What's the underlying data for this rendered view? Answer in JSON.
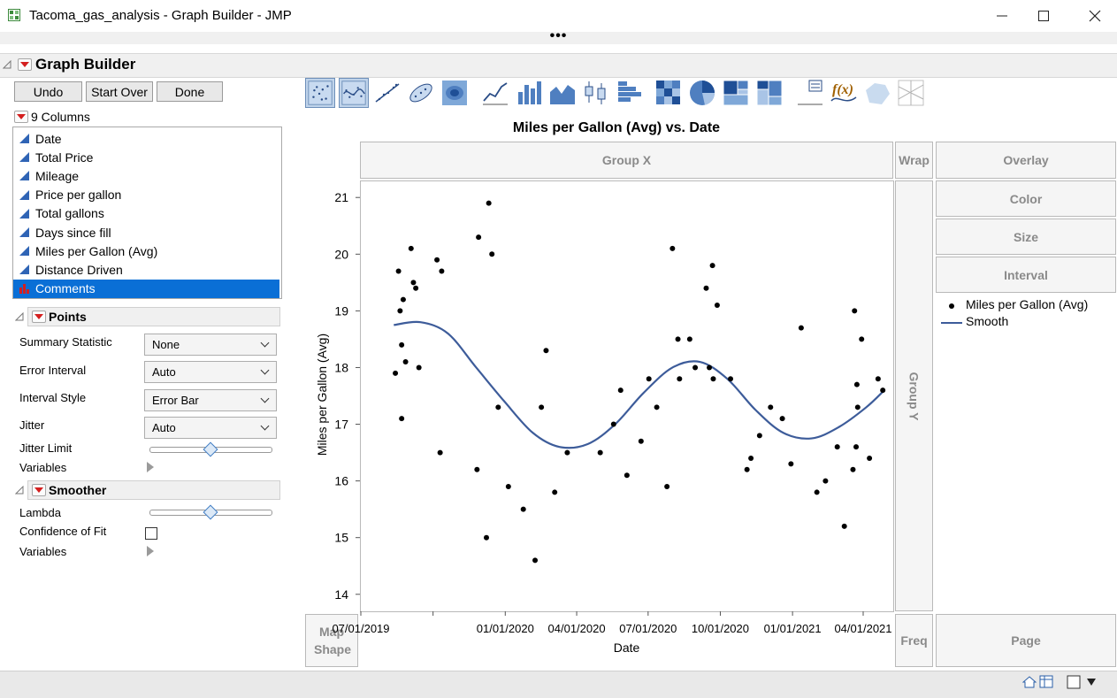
{
  "window": {
    "title": "Tacoma_gas_analysis - Graph Builder - JMP",
    "dots": "•••"
  },
  "header": {
    "title": "Graph Builder"
  },
  "buttons": {
    "undo": "Undo",
    "start_over": "Start Over",
    "done": "Done"
  },
  "columns": {
    "header": "9 Columns",
    "items": [
      {
        "label": "Date",
        "type": "continuous",
        "selected": false
      },
      {
        "label": "Total Price",
        "type": "continuous",
        "selected": false
      },
      {
        "label": "Mileage",
        "type": "continuous",
        "selected": false
      },
      {
        "label": "Price per gallon",
        "type": "continuous",
        "selected": false
      },
      {
        "label": "Total gallons",
        "type": "continuous",
        "selected": false
      },
      {
        "label": "Days since fill",
        "type": "continuous",
        "selected": false
      },
      {
        "label": "Miles per Gallon (Avg)",
        "type": "continuous",
        "selected": false
      },
      {
        "label": "Distance Driven",
        "type": "continuous",
        "selected": false
      },
      {
        "label": "Comments",
        "type": "nominal",
        "selected": true
      }
    ]
  },
  "points": {
    "title": "Points",
    "summary_statistic_label": "Summary Statistic",
    "summary_statistic_value": "None",
    "error_interval_label": "Error Interval",
    "error_interval_value": "Auto",
    "interval_style_label": "Interval Style",
    "interval_style_value": "Error Bar",
    "jitter_label": "Jitter",
    "jitter_value": "Auto",
    "jitter_limit_label": "Jitter Limit",
    "jitter_limit_level": 0.5,
    "variables_label": "Variables"
  },
  "smoother": {
    "title": "Smoother",
    "lambda_label": "Lambda",
    "lambda_level": 0.5,
    "confidence_label": "Confidence of Fit",
    "confidence_checked": false,
    "variables_label": "Variables"
  },
  "zones": {
    "group_x": "Group X",
    "wrap": "Wrap",
    "overlay": "Overlay",
    "color": "Color",
    "size": "Size",
    "interval": "Interval",
    "group_y": "Group Y",
    "map_shape": "Map Shape",
    "freq": "Freq",
    "page": "Page"
  },
  "legend": {
    "points_label": "Miles per Gallon (Avg)",
    "smooth_label": "Smooth"
  },
  "colors": {
    "accent": "#0a6fd6",
    "smooth_line": "#3d5c9a",
    "points": "#000000"
  },
  "chart_data": {
    "type": "scatter",
    "title": "Miles per Gallon (Avg) vs. Date",
    "xlabel": "Date",
    "ylabel": "Miles per Gallon (Avg)",
    "x_ticks": [
      "07/01/2019",
      "01/01/2020",
      "04/01/2020",
      "07/01/2020",
      "10/01/2020",
      "01/01/2021",
      "04/01/2021"
    ],
    "y_ticks": [
      "14",
      "15",
      "16",
      "17",
      "18",
      "19",
      "20",
      "21"
    ],
    "xlim": [
      "2019-07-01",
      "2021-04-30"
    ],
    "ylim": [
      13.7,
      21.3
    ],
    "series": [
      {
        "name": "Miles per Gallon (Avg)",
        "points": [
          [
            "2019-08-14",
            17.9
          ],
          [
            "2019-08-18",
            19.7
          ],
          [
            "2019-08-20",
            19.0
          ],
          [
            "2019-08-22",
            17.1
          ],
          [
            "2019-08-22",
            18.4
          ],
          [
            "2019-08-24",
            19.2
          ],
          [
            "2019-08-27",
            18.1
          ],
          [
            "2019-09-03",
            20.1
          ],
          [
            "2019-09-06",
            19.5
          ],
          [
            "2019-09-09",
            19.4
          ],
          [
            "2019-09-13",
            18.0
          ],
          [
            "2019-10-06",
            19.9
          ],
          [
            "2019-10-10",
            16.5
          ],
          [
            "2019-10-12",
            19.7
          ],
          [
            "2019-11-26",
            16.2
          ],
          [
            "2019-11-28",
            20.3
          ],
          [
            "2019-12-08",
            15.0
          ],
          [
            "2019-12-11",
            20.9
          ],
          [
            "2019-12-15",
            20.0
          ],
          [
            "2019-12-23",
            17.3
          ],
          [
            "2020-01-05",
            15.9
          ],
          [
            "2020-01-24",
            15.5
          ],
          [
            "2020-02-08",
            14.6
          ],
          [
            "2020-02-16",
            17.3
          ],
          [
            "2020-02-22",
            18.3
          ],
          [
            "2020-03-04",
            15.8
          ],
          [
            "2020-03-20",
            16.5
          ],
          [
            "2020-05-01",
            16.5
          ],
          [
            "2020-05-18",
            17.0
          ],
          [
            "2020-05-27",
            17.6
          ],
          [
            "2020-06-04",
            16.1
          ],
          [
            "2020-06-22",
            16.7
          ],
          [
            "2020-07-02",
            17.8
          ],
          [
            "2020-07-12",
            17.3
          ],
          [
            "2020-07-25",
            15.9
          ],
          [
            "2020-08-01",
            20.1
          ],
          [
            "2020-08-08",
            18.5
          ],
          [
            "2020-08-10",
            17.8
          ],
          [
            "2020-08-23",
            18.5
          ],
          [
            "2020-08-30",
            18.0
          ],
          [
            "2020-09-13",
            19.4
          ],
          [
            "2020-09-17",
            18.0
          ],
          [
            "2020-09-21",
            19.8
          ],
          [
            "2020-09-22",
            17.8
          ],
          [
            "2020-09-27",
            19.1
          ],
          [
            "2020-10-14",
            17.8
          ],
          [
            "2020-11-04",
            16.2
          ],
          [
            "2020-11-09",
            16.4
          ],
          [
            "2020-11-20",
            16.8
          ],
          [
            "2020-12-04",
            17.3
          ],
          [
            "2020-12-19",
            17.1
          ],
          [
            "2020-12-30",
            16.3
          ],
          [
            "2021-01-12",
            18.7
          ],
          [
            "2021-02-01",
            15.8
          ],
          [
            "2021-02-12",
            16.0
          ],
          [
            "2021-02-27",
            16.6
          ],
          [
            "2021-03-08",
            15.2
          ],
          [
            "2021-03-19",
            16.2
          ],
          [
            "2021-03-21",
            19.0
          ],
          [
            "2021-03-23",
            16.6
          ],
          [
            "2021-03-24",
            17.7
          ],
          [
            "2021-03-25",
            17.3
          ],
          [
            "2021-03-30",
            18.5
          ],
          [
            "2021-04-09",
            16.4
          ],
          [
            "2021-04-20",
            17.8
          ],
          [
            "2021-04-26",
            17.6
          ]
        ]
      },
      {
        "name": "Smooth",
        "type": "line",
        "points": [
          [
            "2019-08-12",
            18.75
          ],
          [
            "2019-09-15",
            18.8
          ],
          [
            "2019-10-20",
            18.6
          ],
          [
            "2019-11-25",
            18.0
          ],
          [
            "2019-12-31",
            17.4
          ],
          [
            "2020-02-05",
            16.85
          ],
          [
            "2020-03-10",
            16.6
          ],
          [
            "2020-04-15",
            16.65
          ],
          [
            "2020-05-20",
            17.0
          ],
          [
            "2020-06-25",
            17.55
          ],
          [
            "2020-08-01",
            18.0
          ],
          [
            "2020-09-05",
            18.1
          ],
          [
            "2020-10-10",
            17.8
          ],
          [
            "2020-11-15",
            17.25
          ],
          [
            "2020-12-20",
            16.85
          ],
          [
            "2021-01-25",
            16.75
          ],
          [
            "2021-03-01",
            16.95
          ],
          [
            "2021-04-05",
            17.3
          ],
          [
            "2021-04-28",
            17.6
          ]
        ]
      }
    ],
    "legend_position": "right",
    "grid": false
  }
}
